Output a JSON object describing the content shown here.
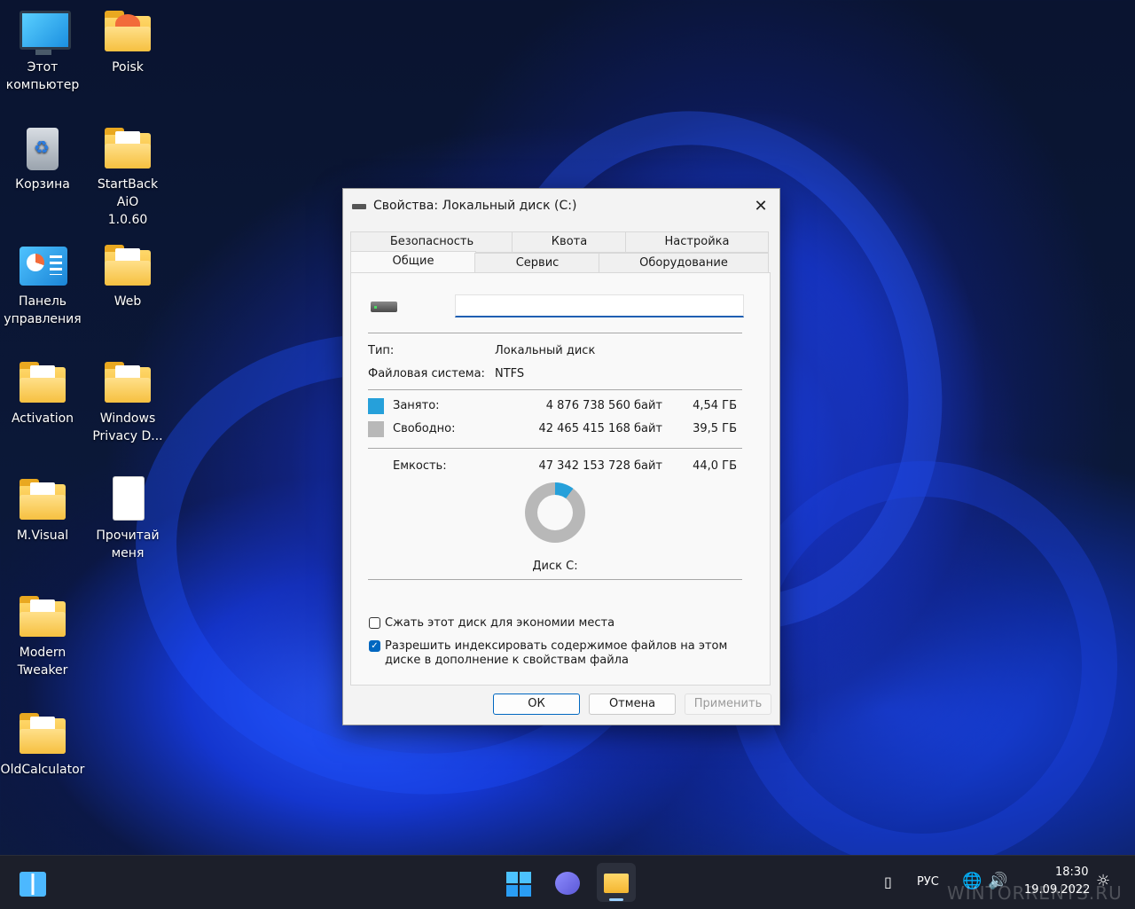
{
  "desktop": {
    "icons": [
      {
        "label": "Этот\nкомпьютер"
      },
      {
        "label": "Poisk"
      },
      {
        "label": "Корзина"
      },
      {
        "label": "StartBack AiO\n1.0.60"
      },
      {
        "label": "Панель\nуправления"
      },
      {
        "label": "Web"
      },
      {
        "label": "Activation"
      },
      {
        "label": "Windows\nPrivacy D..."
      },
      {
        "label": "M.Visual"
      },
      {
        "label": "Прочитай\nменя"
      },
      {
        "label": "Modern\nTweaker"
      },
      {
        "label": "OldCalculator"
      }
    ]
  },
  "dialog": {
    "title": "Свойства: Локальный диск (C:)",
    "close_glyph": "✕",
    "tabs_row1": [
      "Безопасность",
      "Квота",
      "Настройка"
    ],
    "tabs_row2": [
      "Общие",
      "Сервис",
      "Оборудование"
    ],
    "active_tab": "Общие",
    "name_value": "",
    "type_label": "Тип:",
    "type_value": "Локальный диск",
    "fs_label": "Файловая система:",
    "fs_value": "NTFS",
    "used_label": "Занято:",
    "used_bytes": "4 876 738 560 байт",
    "used_size": "4,54 ГБ",
    "free_label": "Свободно:",
    "free_bytes": "42 465 415 168 байт",
    "free_size": "39,5 ГБ",
    "capacity_label": "Емкость:",
    "capacity_bytes": "47 342 153 728 байт",
    "capacity_size": "44,0 ГБ",
    "used_fraction": 0.103,
    "disk_label": "Диск C:",
    "compress_label": "Сжать этот диск для экономии места",
    "compress_checked": false,
    "index_label_1": "Разрешить индексировать содержимое файлов на этом",
    "index_label_2": "диске в дополнение к свойствам файла",
    "index_checked": true,
    "ok_label": "ОК",
    "cancel_label": "Отмена",
    "apply_label": "Применить",
    "colors": {
      "used": "#26a0da",
      "free": "#b8b8b8",
      "accent": "#0067c0"
    }
  },
  "taskbar": {
    "lang": "РУС",
    "time": "18:30",
    "date": "19.09.2022",
    "watermark": "WINTORRENTS.RU"
  }
}
